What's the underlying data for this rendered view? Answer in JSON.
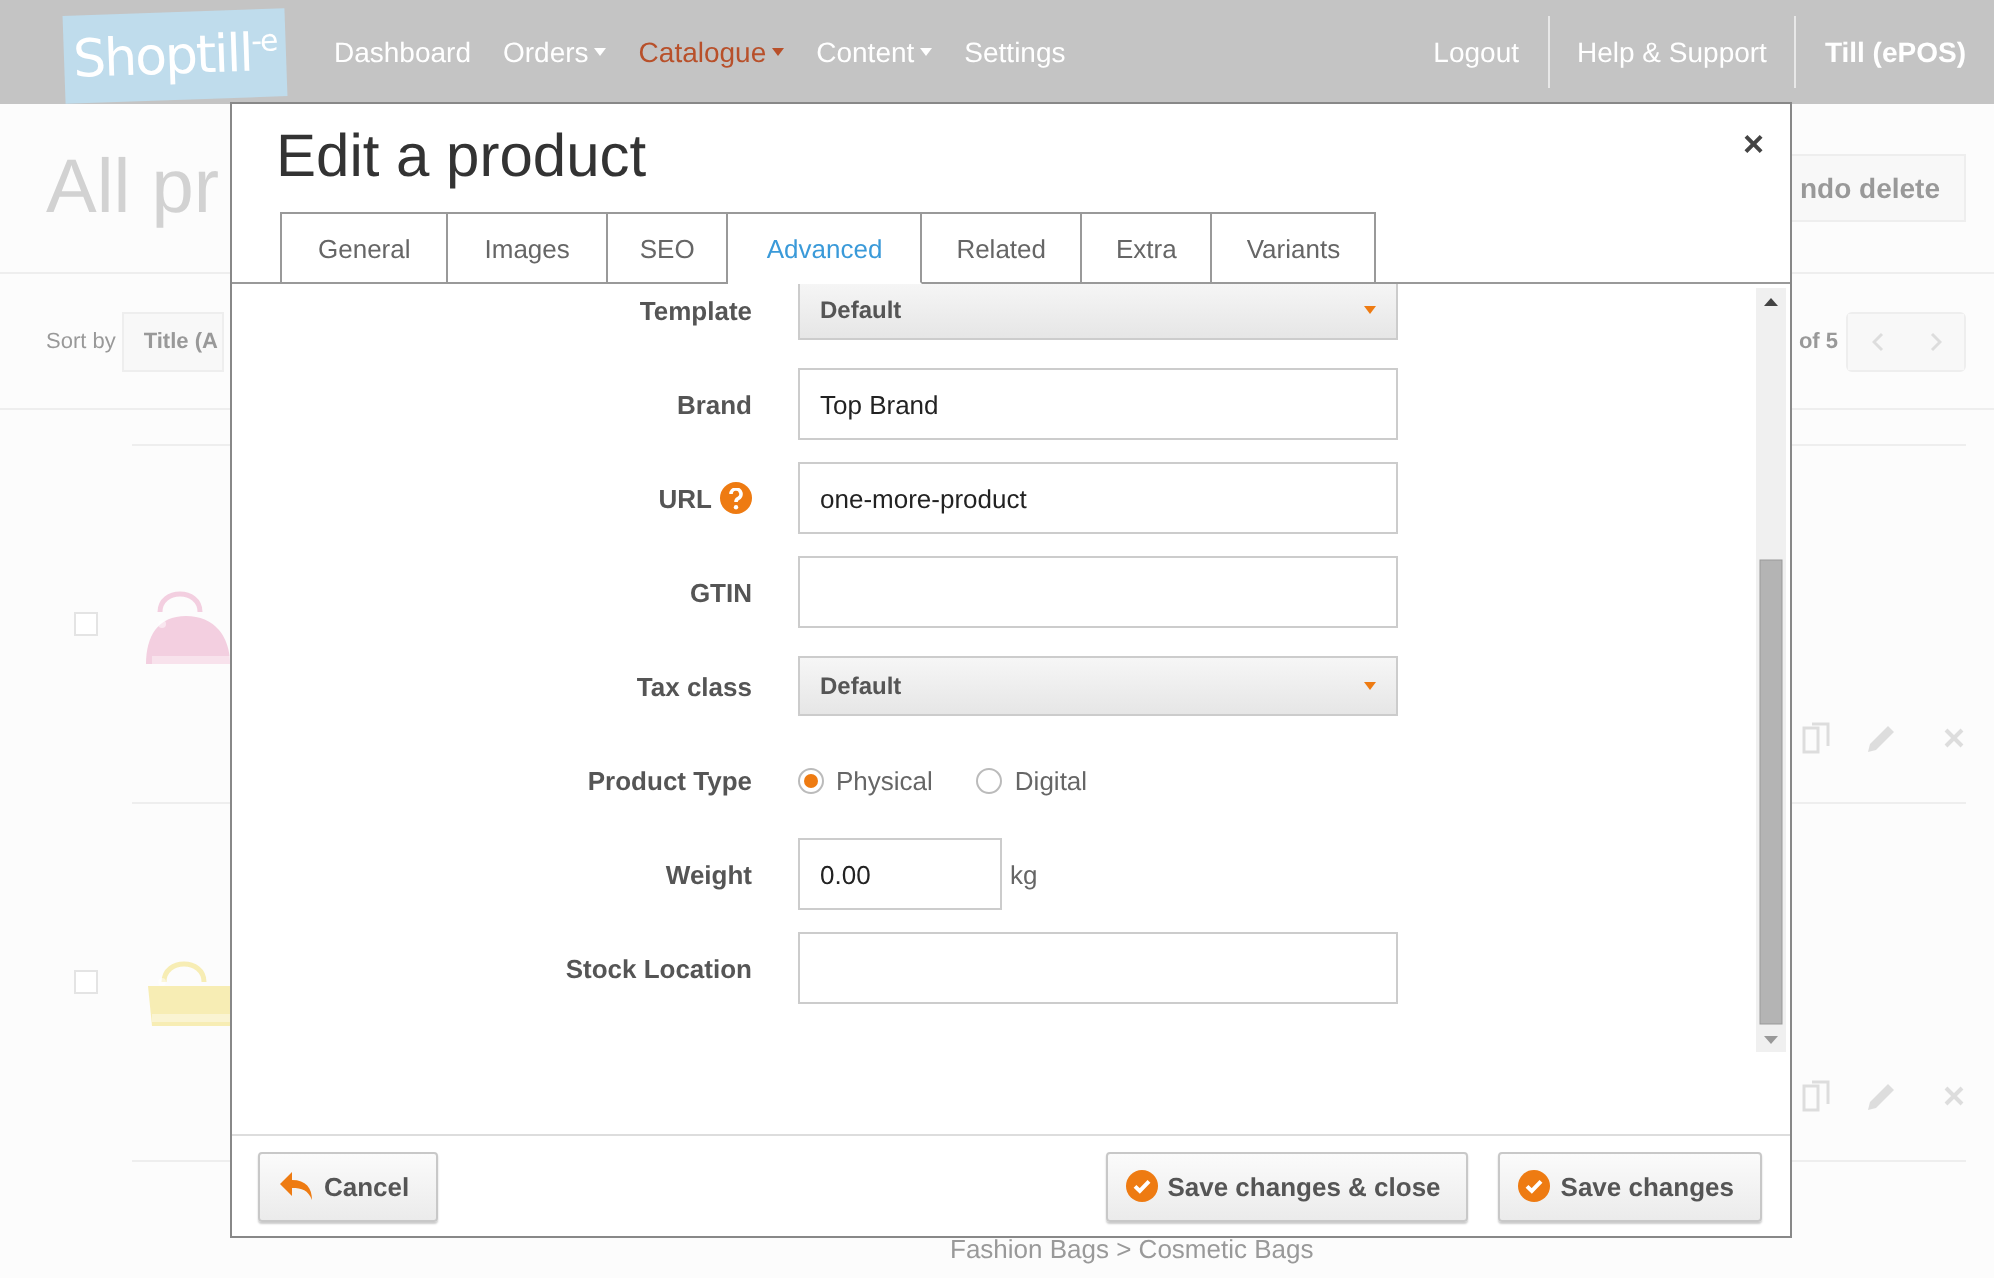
{
  "header": {
    "logo": "Shoptill$^{-e}$",
    "nav": [
      {
        "label": "Dashboard",
        "dropdown": false,
        "selected": false
      },
      {
        "label": "Orders",
        "dropdown": true,
        "selected": false
      },
      {
        "label": "Catalogue",
        "dropdown": true,
        "selected": true
      },
      {
        "label": "Content",
        "dropdown": true,
        "selected": false
      },
      {
        "label": "Settings",
        "dropdown": false,
        "selected": false
      }
    ],
    "right_links": [
      {
        "label": "Logout",
        "bold": false
      },
      {
        "label": "Help & Support",
        "bold": false
      },
      {
        "label": "Till (ePOS)",
        "bold": true
      }
    ]
  },
  "page": {
    "title": "All pr",
    "undo_button": "ndo delete",
    "sort_label": "Sort by",
    "sort_value": "Title (A",
    "pager": "of 5",
    "breadcrumb": "Fashion Bags > Cosmetic Bags"
  },
  "dialog": {
    "title": "Edit a product",
    "close": "×",
    "tabs": [
      {
        "label": "General",
        "selected": false
      },
      {
        "label": "Images",
        "selected": false
      },
      {
        "label": "SEO",
        "selected": false
      },
      {
        "label": "Advanced",
        "selected": true
      },
      {
        "label": "Related",
        "selected": false
      },
      {
        "label": "Extra",
        "selected": false
      },
      {
        "label": "Variants",
        "selected": false
      }
    ],
    "fields": [
      {
        "kind": "select",
        "label": "Template",
        "value": "Default"
      },
      {
        "kind": "text",
        "label": "Brand",
        "value": "Top Brand"
      },
      {
        "kind": "text",
        "label": "URL",
        "value": "one-more-product",
        "help": true
      },
      {
        "kind": "text",
        "label": "GTIN"
      },
      {
        "kind": "select",
        "label": "Tax class",
        "value": "Default"
      },
      {
        "kind": "radio",
        "label": "Product Type",
        "options": [
          {
            "label": "Physical",
            "selected": true
          },
          {
            "label": "Digital",
            "selected": false
          }
        ]
      },
      {
        "kind": "unit",
        "label": "Weight",
        "value": "0.00",
        "unit": "kg"
      },
      {
        "kind": "text",
        "label": "Stock Location"
      }
    ],
    "buttons": [
      {
        "kind": "cancel",
        "label": "Cancel"
      },
      {
        "kind": "save",
        "label": "Save changes & close"
      },
      {
        "kind": "save",
        "label": "Save changes"
      }
    ]
  }
}
